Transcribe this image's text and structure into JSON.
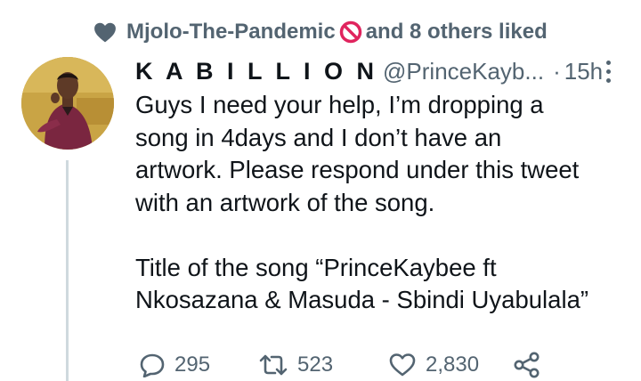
{
  "social_context": {
    "liker_name": "Mjolo-The-Pandemic",
    "suffix": "and 8 others liked"
  },
  "tweet": {
    "display_name": "K A B I L L I O N",
    "handle": "@PrinceKayb...",
    "separator": "·",
    "time": "15h",
    "text": "Guys I need your help, I’m dropping a\nsong in 4days and I don’t have an\nartwork. Please respond under this tweet\nwith an artwork of the song.\n\nTitle of the song “PrinceKaybee ft\nNkosazana & Masuda - Sbindi Uyabulala”"
  },
  "actions": {
    "replies": "295",
    "retweets": "523",
    "likes": "2,830"
  },
  "colors": {
    "secondary_text": "#536471",
    "prohibited_red": "#e0245e",
    "thread_line": "#cfd9de"
  },
  "icons": [
    "heart-icon",
    "prohibited-icon",
    "more-icon",
    "reply-icon",
    "retweet-icon",
    "like-icon",
    "share-icon"
  ]
}
